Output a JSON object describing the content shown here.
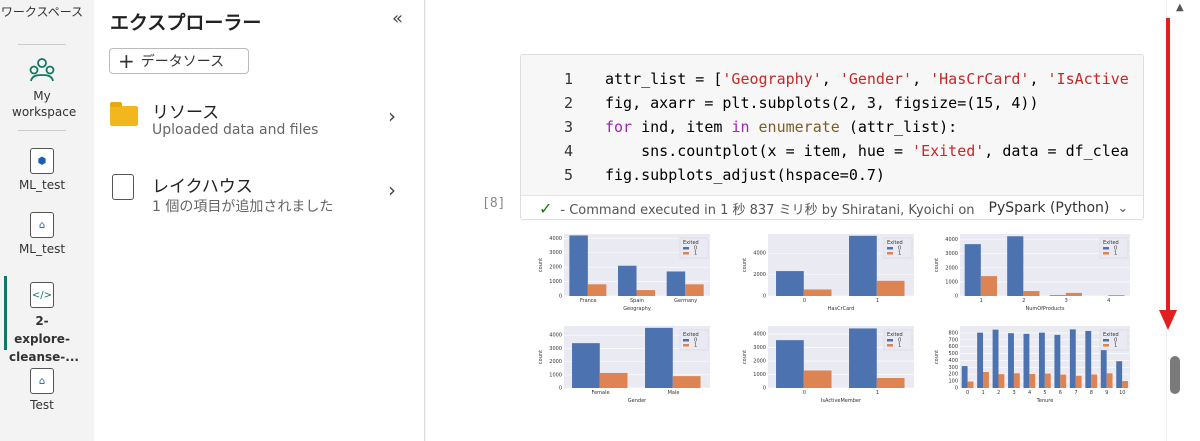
{
  "nav": {
    "workspaces_label": "ワークスペース",
    "items": [
      {
        "label": "My workspace",
        "icon": "people-icon"
      },
      {
        "label": "ML_test",
        "icon": "model-icon"
      },
      {
        "label": "ML_test",
        "icon": "lakehouse-icon"
      },
      {
        "label": "2-explore-cleanse-...",
        "icon": "notebook-icon"
      },
      {
        "label": "Test",
        "icon": "lakehouse-icon"
      }
    ]
  },
  "explorer": {
    "title": "エクスプローラー",
    "collapse_glyph": "«",
    "add_source_label": "データソース",
    "items": [
      {
        "label": "リソース",
        "sub": "Uploaded data and files",
        "icon": "folder-icon"
      },
      {
        "label": "レイクハウス",
        "sub": "1 個の項目が追加されました",
        "icon": "lakehouse-icon"
      }
    ]
  },
  "cell": {
    "execution_count": "[8]",
    "lines": [
      {
        "n": "1",
        "text": "attr_list = ['Geography', 'Gender', 'HasCrCard', 'IsActive"
      },
      {
        "n": "2",
        "text": "fig, axarr = plt.subplots(2, 3, figsize=(15, 4))"
      },
      {
        "n": "3",
        "text": "for ind, item in enumerate (attr_list):"
      },
      {
        "n": "4",
        "text": "    sns.countplot(x = item, hue = 'Exited', data = df_clea"
      },
      {
        "n": "5",
        "text": "fig.subplots_adjust(hspace=0.7)"
      }
    ],
    "status": "- Command executed in 1 秒 837 ミリ秒 by Shiratani, Kyoichi on",
    "language": "PySpark (Python)"
  },
  "colors": {
    "series0": "#4c72b0",
    "series1": "#dd8452",
    "plot_bg": "#eaeaf2"
  },
  "chart_data": [
    {
      "type": "bar",
      "xlabel": "Geography",
      "ylabel": "count",
      "legend_title": "Exited",
      "categories": [
        "France",
        "Spain",
        "Germany"
      ],
      "series": [
        {
          "name": "0",
          "values": [
            4200,
            2100,
            1700
          ]
        },
        {
          "name": "1",
          "values": [
            810,
            410,
            810
          ]
        }
      ],
      "ylim": [
        0,
        4300
      ],
      "yticks": [
        0,
        1000,
        2000,
        3000,
        4000
      ]
    },
    {
      "type": "bar",
      "xlabel": "HasCrCard",
      "ylabel": "count",
      "legend_title": "Exited",
      "categories": [
        "0",
        "1"
      ],
      "series": [
        {
          "name": "0",
          "values": [
            2330,
            5630
          ]
        },
        {
          "name": "1",
          "values": [
            610,
            1420
          ]
        }
      ],
      "ylim": [
        0,
        5800
      ],
      "yticks": [
        0,
        2000,
        4000
      ]
    },
    {
      "type": "bar",
      "xlabel": "NumOfProducts",
      "ylabel": "count",
      "legend_title": "Exited",
      "categories": [
        "1",
        "2",
        "3",
        "4"
      ],
      "series": [
        {
          "name": "0",
          "values": [
            3680,
            4240,
            46,
            0
          ]
        },
        {
          "name": "1",
          "values": [
            1410,
            350,
            220,
            60
          ]
        }
      ],
      "ylim": [
        0,
        4400
      ],
      "yticks": [
        0,
        1000,
        2000,
        3000,
        4000
      ]
    },
    {
      "type": "bar",
      "xlabel": "Gender",
      "ylabel": "count",
      "legend_title": "Exited",
      "categories": [
        "Female",
        "Male"
      ],
      "series": [
        {
          "name": "0",
          "values": [
            3400,
            4560
          ]
        },
        {
          "name": "1",
          "values": [
            1140,
            900
          ]
        }
      ],
      "ylim": [
        0,
        4700
      ],
      "yticks": [
        0,
        1000,
        2000,
        3000,
        4000
      ]
    },
    {
      "type": "bar",
      "xlabel": "IsActiveMember",
      "ylabel": "count",
      "legend_title": "Exited",
      "categories": [
        "0",
        "1"
      ],
      "series": [
        {
          "name": "0",
          "values": [
            3550,
            4420
          ]
        },
        {
          "name": "1",
          "values": [
            1300,
            740
          ]
        }
      ],
      "ylim": [
        0,
        4600
      ],
      "yticks": [
        0,
        1000,
        2000,
        3000,
        4000
      ]
    },
    {
      "type": "bar",
      "xlabel": "Tenure",
      "ylabel": "count",
      "legend_title": "Exited",
      "categories": [
        "0",
        "1",
        "2",
        "3",
        "4",
        "5",
        "6",
        "7",
        "8",
        "9",
        "10"
      ],
      "series": [
        {
          "name": "0",
          "values": [
            318,
            803,
            847,
            796,
            786,
            803,
            771,
            851,
            828,
            771,
            389
          ]
        },
        {
          "name": "1",
          "values": [
            95,
            232,
            201,
            213,
            203,
            209,
            196,
            177,
            197,
            213,
            101
          ]
        }
      ],
      "ylim": [
        0,
        900
      ],
      "yticks": [
        0,
        100,
        200,
        300,
        400,
        500,
        600,
        700,
        800
      ]
    }
  ]
}
